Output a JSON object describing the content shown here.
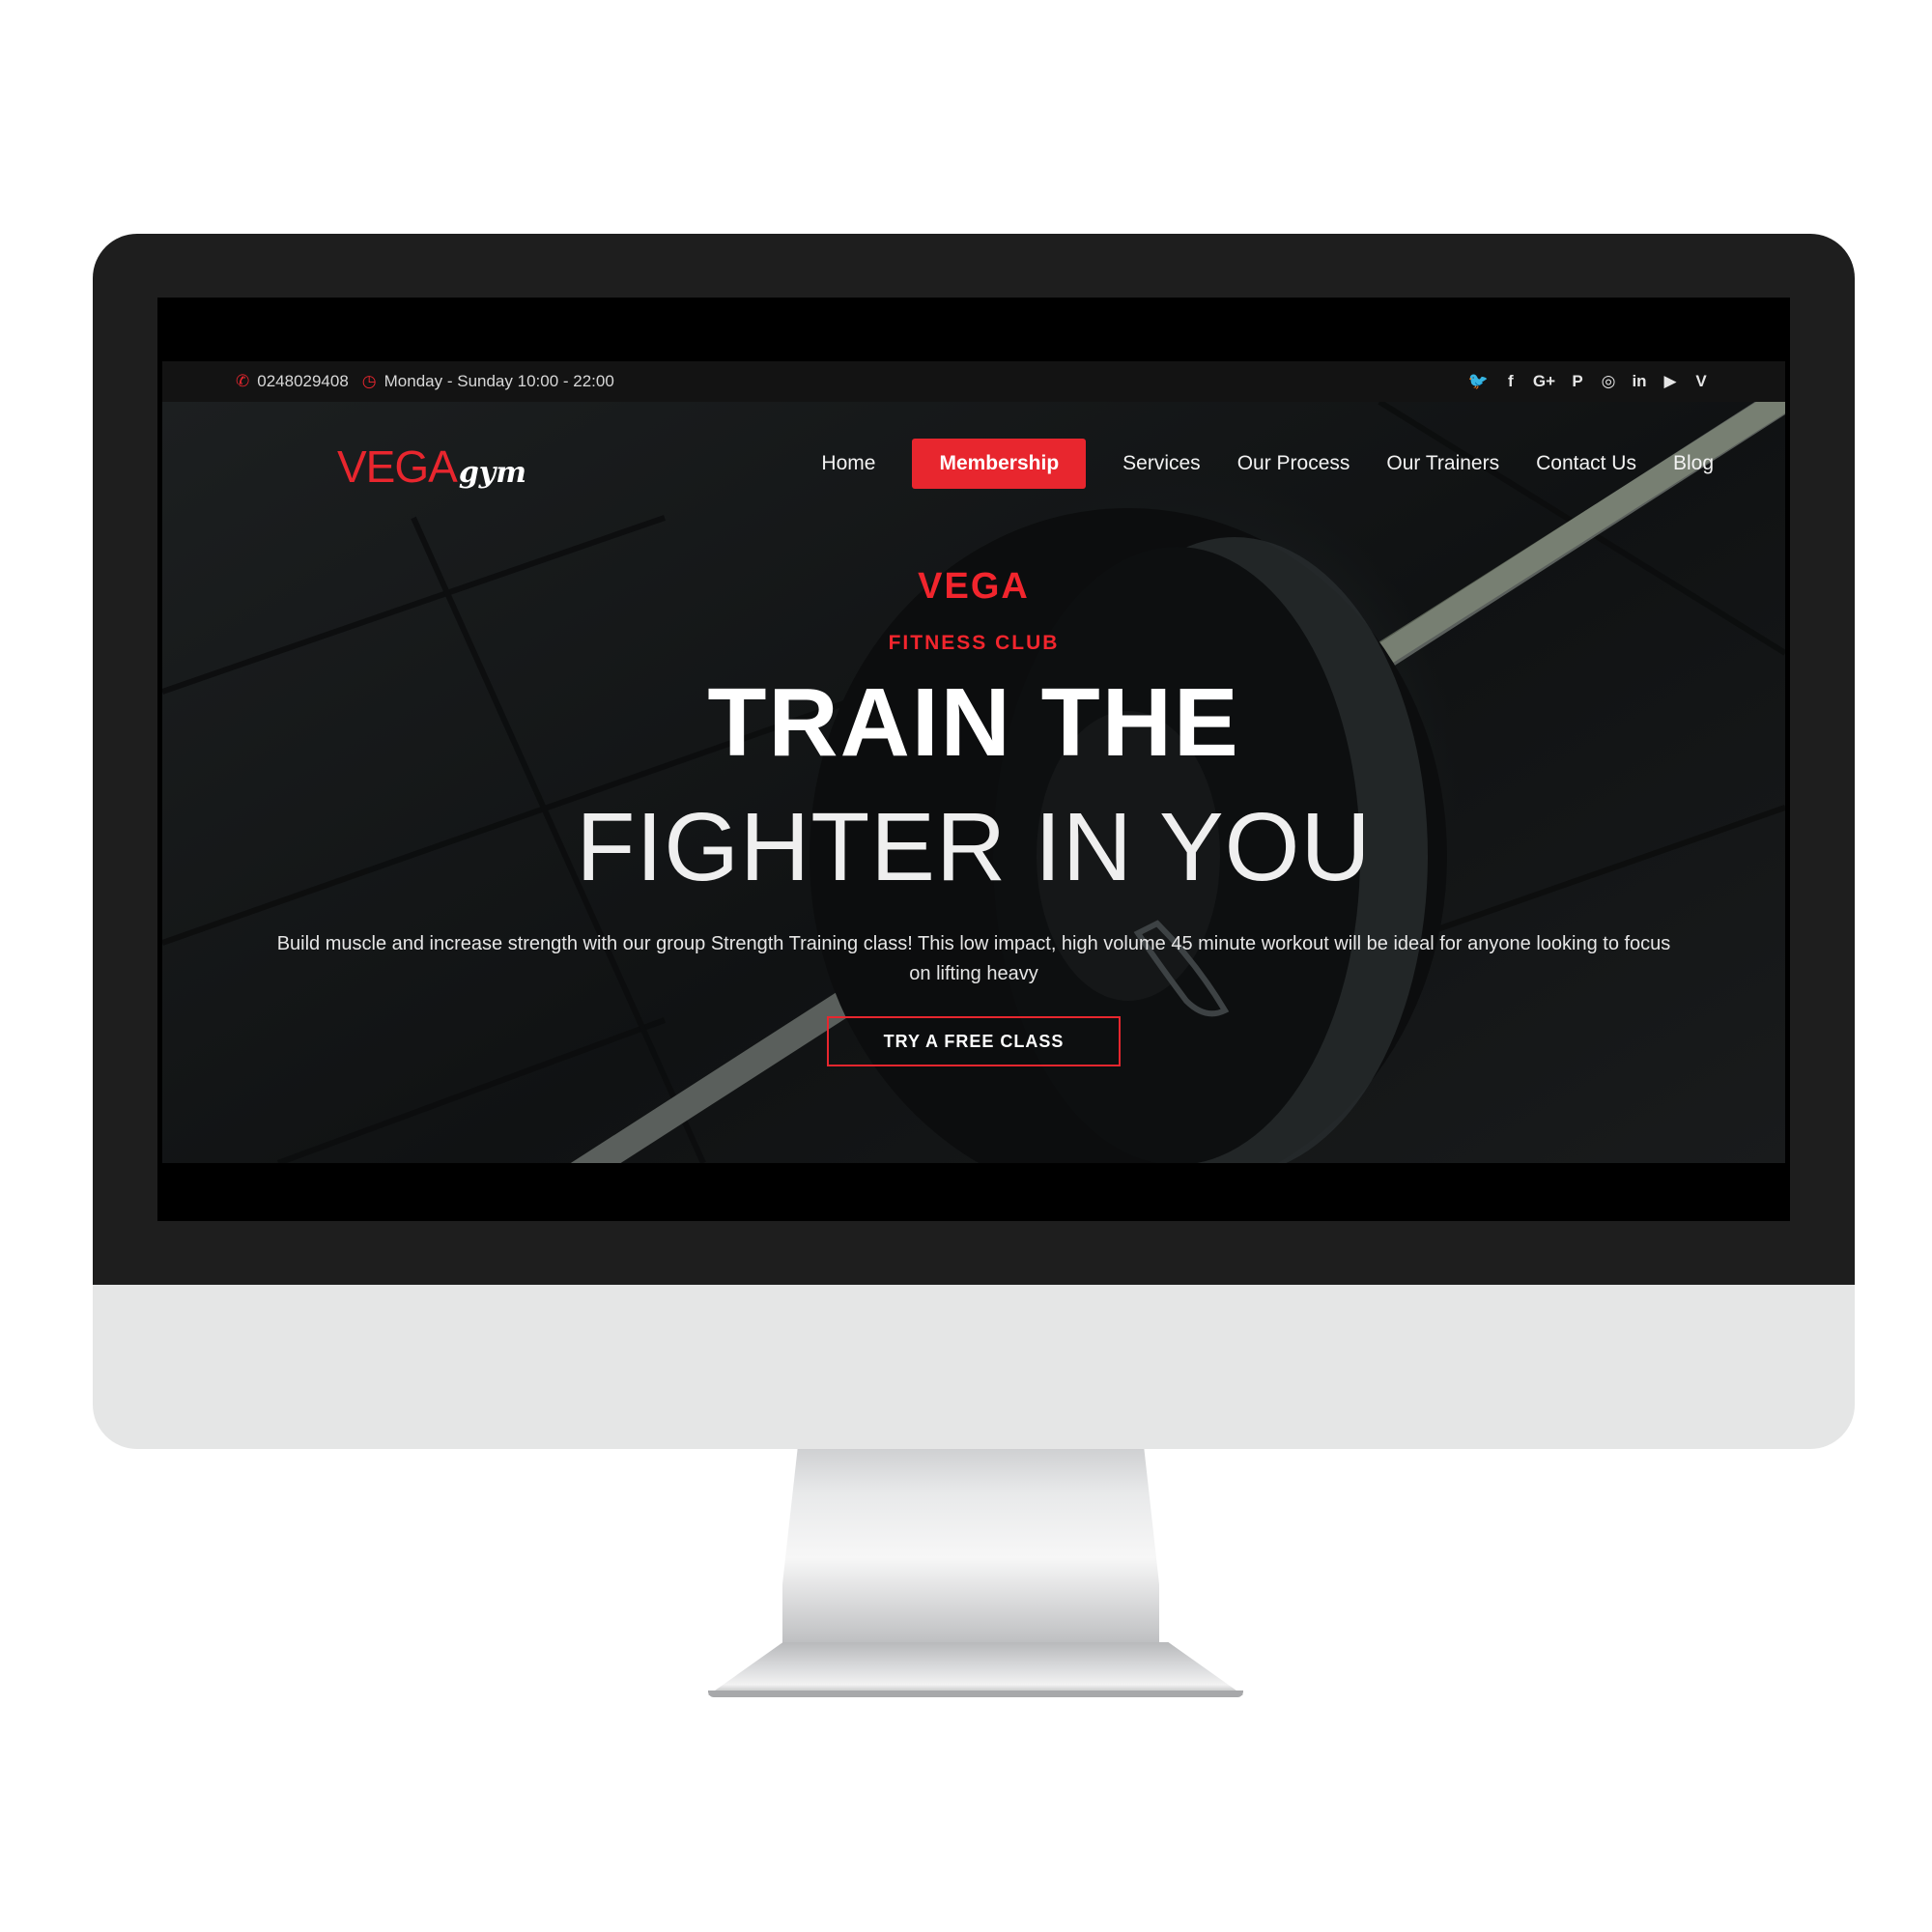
{
  "topbar": {
    "phone": "0248029408",
    "hours": "Monday - Sunday 10:00 - 22:00",
    "social": [
      {
        "icon": "twitter-icon",
        "glyph": "🐦"
      },
      {
        "icon": "facebook-icon",
        "glyph": "f"
      },
      {
        "icon": "google-plus-icon",
        "glyph": "G+"
      },
      {
        "icon": "pinterest-icon",
        "glyph": "P"
      },
      {
        "icon": "instagram-icon",
        "glyph": "◎"
      },
      {
        "icon": "linkedin-icon",
        "glyph": "in"
      },
      {
        "icon": "youtube-icon",
        "glyph": "▶"
      },
      {
        "icon": "vine-icon",
        "glyph": "V"
      }
    ]
  },
  "logo": {
    "main": "VEGA",
    "script": "gym"
  },
  "nav": {
    "items": [
      "Home",
      "Membership",
      "Services",
      "Our Process",
      "Our Trainers",
      "Contact Us",
      "Blog"
    ],
    "active": "Membership"
  },
  "hero": {
    "brand": "VEGA",
    "subtitle": "FITNESS CLUB",
    "headline_line1": "TRAIN THE",
    "headline_line2": "FIGHTER IN YOU",
    "description": "Build muscle and increase strength with our group Strength Training class! This low impact, high volume 45 minute workout will be ideal for anyone looking to focus on lifting heavy",
    "cta": "TRY A FREE CLASS"
  },
  "colors": {
    "accent": "#e8262e",
    "bezel": "#1e1e1e",
    "topbar": "#131313",
    "chin": "#e5e6e6"
  }
}
